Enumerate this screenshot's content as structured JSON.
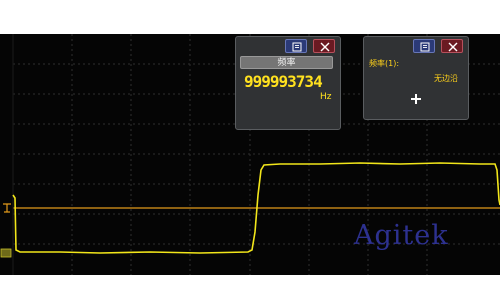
{
  "measure_panel": {
    "frequency_button_label": "频率",
    "frequency_value": "999993734",
    "frequency_unit": "Hz",
    "menu_icon": "menu-icon",
    "close_icon": "close-icon"
  },
  "channel_panel": {
    "channel_label": "频率(1):",
    "mode_label": "无边沿",
    "add_icon": "plus-icon",
    "menu_icon": "menu-icon",
    "close_icon": "close-icon"
  },
  "watermark": "Agitek",
  "colors": {
    "trace": "#f2e61a",
    "grid": "#2e2e2e",
    "cursor": "#e29a1b",
    "panel_bg": "#303234",
    "panel_text": "#ffd21a",
    "watermark": "#2d3190"
  }
}
